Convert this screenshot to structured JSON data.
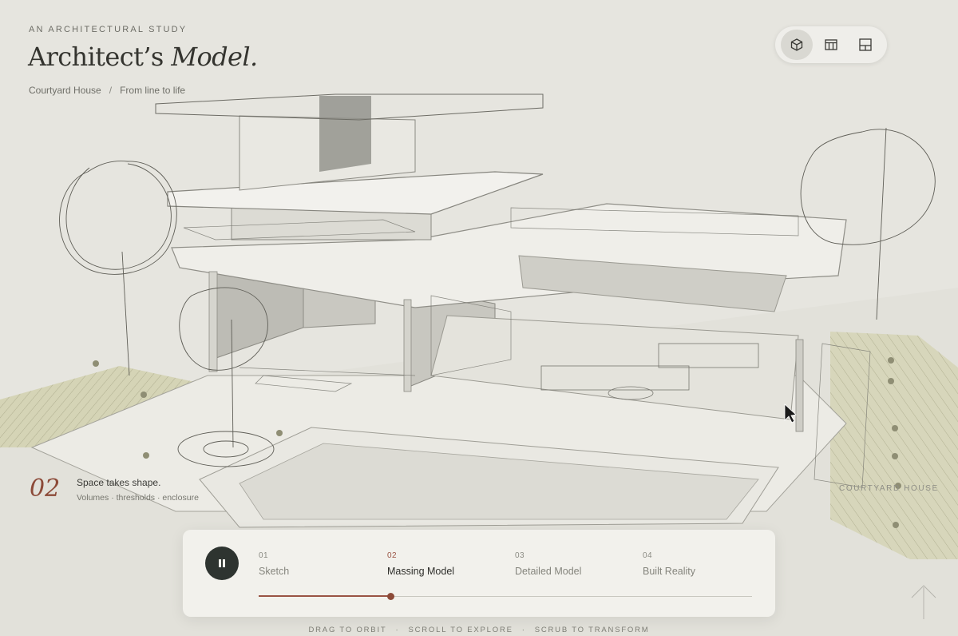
{
  "header": {
    "eyebrow": "AN ARCHITECTURAL STUDY",
    "title_plain": "Architect’s",
    "title_italic": "Model.",
    "breadcrumb": {
      "project": "Courtyard House",
      "separator": "/",
      "subtitle": "From line to life"
    }
  },
  "view_switcher": {
    "buttons": [
      {
        "icon": "cube-3d-icon",
        "active": true
      },
      {
        "icon": "elevation-icon",
        "active": false
      },
      {
        "icon": "floor-plan-icon",
        "active": false
      }
    ]
  },
  "stage_caption": {
    "number": "02",
    "title": "Space takes shape.",
    "subtitle": "Volumes · thresholds · enclosure"
  },
  "watermark": "COURTYARD HOUSE",
  "timeline": {
    "playing": true,
    "progress": 0.267,
    "steps": [
      {
        "num": "01",
        "label": "Sketch"
      },
      {
        "num": "02",
        "label": "Massing Model"
      },
      {
        "num": "03",
        "label": "Detailed Model"
      },
      {
        "num": "04",
        "label": "Built Reality"
      }
    ],
    "active_step": 1
  },
  "hints": {
    "orbit": "DRAG TO ORBIT",
    "scroll": "SCROLL TO EXPLORE",
    "scrub": "SCRUB TO TRANSFORM",
    "separator": "·"
  },
  "colors": {
    "accent": "#8c4a38",
    "background": "#e6e5df",
    "dark_button": "#2e3430",
    "hatch": "#c8c7a4"
  }
}
